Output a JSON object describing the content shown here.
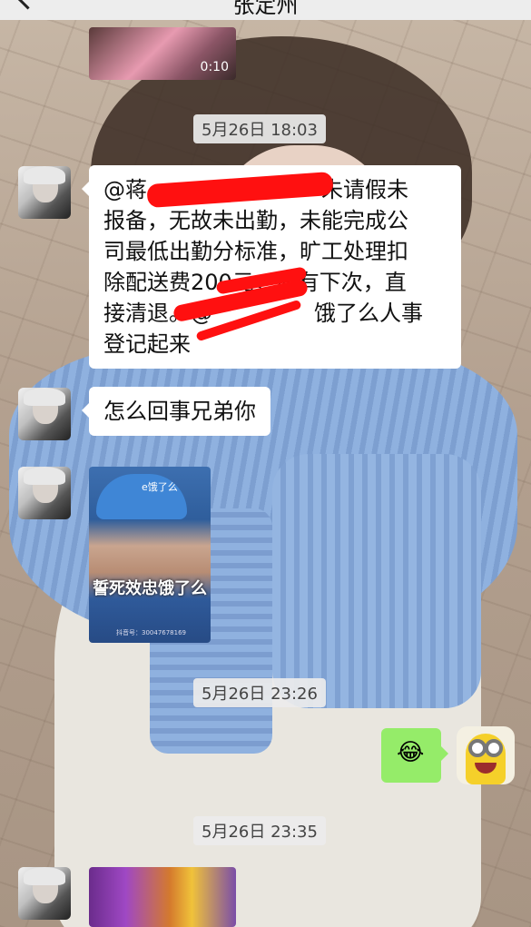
{
  "header": {
    "title": "张定州",
    "back_icon": "chevron-left-icon"
  },
  "video": {
    "duration": "0:10"
  },
  "timestamps": [
    "5月26日 18:03",
    "5月26日 23:26",
    "5月26日 23:35"
  ],
  "messages": {
    "notice": {
      "line1_prefix": "@蒋",
      "line1_suffix": "未请假未",
      "line2": "报备，无故未出勤，未能完成公",
      "line3": "司最低出勤分标准，旷工处理扣",
      "line4": "除配送费200元，如有下次，直",
      "line5_prefix": "接清退。@",
      "line5_suffix": "饿了么人事",
      "line6": "登记起来"
    },
    "question": "怎么回事兄弟你",
    "meme_caption": "誓死效忠饿了么",
    "meme_logo": "e饿了么",
    "meme_watermark": "抖音号：30047678169"
  },
  "colors": {
    "redaction": "#ff1010",
    "sent_bubble": "#95ec69",
    "received_bubble": "#ffffff"
  }
}
